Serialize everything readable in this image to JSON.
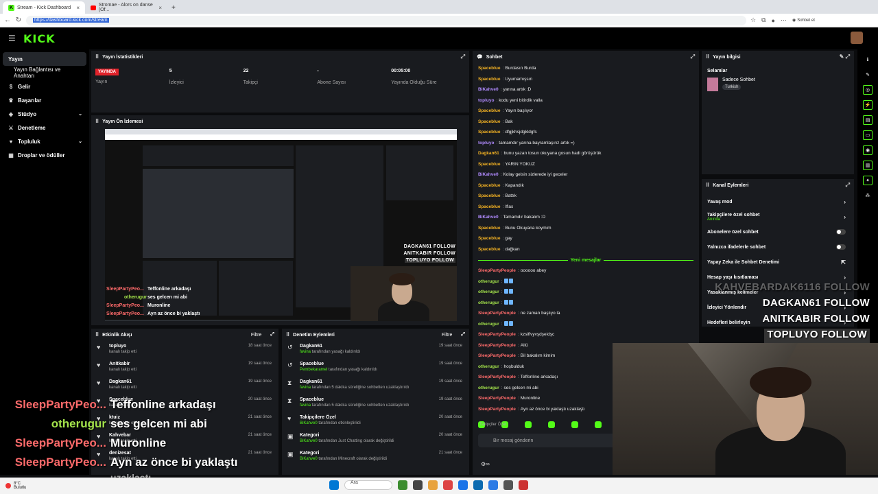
{
  "browser": {
    "tabs": [
      {
        "label": "Stream - Kick Dashboard",
        "active": true
      },
      {
        "label": "Stromae - Alors on danse (Of...",
        "active": false
      }
    ],
    "url": "https://dashboard.kick.com/stream",
    "sohbet_label": "Sohbet et"
  },
  "app": {
    "logo": "KICK"
  },
  "sidebar": {
    "items": [
      {
        "label": "Yayın",
        "icon": "broadcast-icon"
      },
      {
        "label": "Yayın Bağlantısı ve Anahtarı",
        "icon": ""
      },
      {
        "label": "Gelir",
        "icon": "money-icon"
      },
      {
        "label": "Başarılar",
        "icon": "trophy-icon"
      },
      {
        "label": "Stüdyo",
        "icon": "studio-icon"
      },
      {
        "label": "Denetleme",
        "icon": "sword-icon"
      },
      {
        "label": "Topluluk",
        "icon": "community-icon"
      },
      {
        "label": "Droplar ve ödüller",
        "icon": "gift-icon"
      }
    ]
  },
  "stats": {
    "title": "Yayın İstatistikleri",
    "live_badge": "YAYINDA",
    "live_label": "Yayın",
    "items": [
      {
        "value": "5",
        "label": "İzleyici"
      },
      {
        "value": "22",
        "label": "Takipçi"
      },
      {
        "value": "-",
        "label": "Abone Sayısı"
      },
      {
        "value": "00:05:00",
        "label": "Yayında Olduğu Süre"
      }
    ]
  },
  "preview": {
    "title": "Yayın Ön İzlemesi",
    "chat_lines": [
      {
        "user": "SleepPartyPeo...",
        "msg": "Teffonline arkadaşı"
      },
      {
        "user": "otherugur",
        "msg": "ses gelcen mi abi"
      },
      {
        "user": "SleepPartyPeo...",
        "msg": "Muronline"
      },
      {
        "user": "SleepPartyPeo...",
        "msg": "Ayn az önce bi yaklaştı"
      }
    ],
    "follows": [
      "DAGKAN61 FOLLOW",
      "ANITKABIR FOLLOW",
      "TOPLUYO FOLLOW"
    ]
  },
  "activity": {
    "title": "Etkinlik Akışı",
    "filter": "Filtre",
    "items": [
      {
        "name": "topluyo",
        "sub": "kanalı takip etti",
        "time": "18 saat önce"
      },
      {
        "name": "Anitkabir",
        "sub": "kanalı takip etti",
        "time": "19 saat önce"
      },
      {
        "name": "Dagkan61",
        "sub": "kanalı takip etti",
        "time": "19 saat önce"
      },
      {
        "name": "Spacebluе",
        "sub": "kanalı takip etti",
        "time": "20 saat önce"
      },
      {
        "name": "ktuiz",
        "sub": "kanalı takip etti",
        "time": "21 saat önce"
      },
      {
        "name": "Kahvebar",
        "sub": "kanalı takip etti",
        "time": "21 saat önce"
      },
      {
        "name": "denizesat",
        "sub": "kanalı takip etti",
        "time": "21 saat önce"
      }
    ]
  },
  "moderation": {
    "title": "Denetim Eylemleri",
    "filter": "Filtre",
    "items": [
      {
        "name": "Dagkan61",
        "actor": "favina",
        "sub": " tarafından yasağı kaldırıldı",
        "time": "19 saat önce",
        "icon": "undo-icon"
      },
      {
        "name": "Spacebluе",
        "actor": "Pembekaramel",
        "sub": " tarafından yasağı kaldırıldı",
        "time": "19 saat önce",
        "icon": "undo-icon"
      },
      {
        "name": "Dagkan61",
        "actor": "favina",
        "sub": " tarafından 5 dakika süreliğine sohbetten uzaklaştırıldı",
        "time": "19 saat önce",
        "icon": "hourglass-icon"
      },
      {
        "name": "Spacebluе",
        "actor": "favina",
        "sub": " tarafından 5 dakika süreliğine sohbetten uzaklaştırıldı",
        "time": "19 saat önce",
        "icon": "hourglass-icon"
      },
      {
        "name": "Takipçilere Özel",
        "actor": "BiKahve0",
        "sub": " tarafından etkinleştirildi",
        "time": "20 saat önce",
        "icon": "heart-icon"
      },
      {
        "name": "Kategori",
        "actor": "BiKahve0",
        "sub": " tarafından Just Chatting olarak değiştirildi",
        "time": "20 saat önce",
        "icon": "category-icon"
      },
      {
        "name": "Kategori",
        "actor": "BiKahve0",
        "sub": " tarafından Minecraft olarak değiştirildi",
        "time": "21 saat önce",
        "icon": "category-icon"
      }
    ]
  },
  "chat": {
    "title": "Sohbet",
    "messages": [
      {
        "user": "Spacebluе",
        "text": "Burdasın Burda",
        "color": "#f5b323"
      },
      {
        "user": "Spacebluе",
        "text": "Uyumamışsın",
        "color": "#f5b323"
      },
      {
        "user": "BiKahve0",
        "text": "yarına artık :D",
        "color": "#b18bff"
      },
      {
        "user": "topluyo",
        "text": "kodu yeni bitirdik valla",
        "color": "#b18bff"
      },
      {
        "user": "Spacebluе",
        "text": "Yayın başlıyor",
        "color": "#f5b323"
      },
      {
        "user": "Spacebluе",
        "text": "Bak",
        "color": "#f5b323"
      },
      {
        "user": "Spacebluе",
        "text": "dfgjkhsjdgkldgfs",
        "color": "#f5b323"
      },
      {
        "user": "topluyo",
        "text": "tamamdır yarına bayramlaşırız artık =)",
        "color": "#b18bff"
      },
      {
        "user": "Dagkan61",
        "text": "bunu yazan tosun okuyana gosun hadi görüşürük",
        "color": "#f5b323"
      },
      {
        "user": "Spacebluе",
        "text": "YARIN YOKUZ",
        "color": "#f5b323"
      },
      {
        "user": "BiKahve0",
        "text": "Kolay gelsin sizlerede iyi geceler",
        "color": "#b18bff"
      },
      {
        "user": "Spacebluе",
        "text": "Kapandık",
        "color": "#f5b323"
      },
      {
        "user": "Spacebluе",
        "text": "Battık",
        "color": "#f5b323"
      },
      {
        "user": "Spacebluе",
        "text": "Iflas",
        "color": "#f5b323"
      },
      {
        "user": "BiKahve0",
        "text": "Tamamdır bakalım :D",
        "color": "#b18bff"
      },
      {
        "user": "Spacebluе",
        "text": "Bunu Okuyana koymim",
        "color": "#f5b323"
      },
      {
        "user": "Spacebluе",
        "text": "gay",
        "color": "#f5b323"
      },
      {
        "user": "Spacebluе",
        "text": "dağkan",
        "color": "#f5b323"
      }
    ],
    "new_label": "Yeni mesajlar",
    "new_messages": [
      {
        "user": "SleepPartyPeople",
        "text": "oooooo abey",
        "color": "#ff6b6b"
      },
      {
        "user": "otherugur",
        "text": "",
        "color": "#a4e34b"
      },
      {
        "user": "otherugur",
        "text": "",
        "color": "#a4e34b"
      },
      {
        "user": "otherugur",
        "text": "",
        "color": "#a4e34b"
      },
      {
        "user": "SleepPartyPeople",
        "text": "ne zaman başlıyo la",
        "color": "#ff6b6b"
      },
      {
        "user": "otherugur",
        "text": "",
        "color": "#a4e34b"
      },
      {
        "user": "SleepPartyPeople",
        "text": "kzsiflvyvşdşeidşc",
        "color": "#ff6b6b"
      },
      {
        "user": "SleepPartyPeople",
        "text": "Allü",
        "color": "#ff6b6b"
      },
      {
        "user": "SleepPartyPeople",
        "text": "Bil bakalım kimim",
        "color": "#ff6b6b"
      },
      {
        "user": "otherugur",
        "text": "hoşbulduk",
        "color": "#a4e34b"
      },
      {
        "user": "SleepPartyPeople",
        "text": "Teffonline arkadaşı",
        "color": "#ff6b6b"
      },
      {
        "user": "otherugur",
        "text": "ses gelcen mi abi",
        "color": "#a4e34b"
      },
      {
        "user": "SleepPartyPeople",
        "text": "Muronline",
        "color": "#ff6b6b"
      },
      {
        "user": "SleepPartyPeople",
        "text": "Ayn az önce bi yaklaştı uzaklaştı",
        "color": "#ff6b6b"
      }
    ],
    "followers_only": "Takipçiler Özel",
    "input_placeholder": "Bir mesaj gönderin"
  },
  "stream_info": {
    "title": "Yayın bilgisi",
    "stream_title": "Selamlar",
    "category": "Sadece Sohbet",
    "language": "Turkish"
  },
  "channel_actions": {
    "title": "Kanal Eylemleri",
    "items": [
      {
        "label": "Yavaş mod",
        "type": "chevron",
        "sub": ""
      },
      {
        "label": "Takipçilere özel sohbet",
        "type": "chevron",
        "sub": "Anında"
      },
      {
        "label": "Abonelere özel sohbet",
        "type": "toggle",
        "sub": ""
      },
      {
        "label": "Yalnızca ifadelerle sohbet",
        "type": "toggle",
        "sub": ""
      },
      {
        "label": "Yapay Zeka ile Sohbet Denetimi",
        "type": "external",
        "sub": ""
      },
      {
        "label": "Hesap yaşı kısıtlaması",
        "type": "chevron",
        "sub": ""
      },
      {
        "label": "Yasaklanmış kelimeler",
        "type": "chevron",
        "sub": ""
      },
      {
        "label": "İzleyici Yönlendir",
        "type": "chevron",
        "sub": ""
      },
      {
        "label": "Hedefleri belirleyin",
        "type": "chevron",
        "sub": ""
      }
    ]
  },
  "overlay": {
    "chat": [
      {
        "user": "SleepPartyPeo...",
        "msg": "Teffonline arkadaşı",
        "color": "#ff6b6b"
      },
      {
        "user": "otherugur",
        "msg": "ses gelcen mi abi",
        "color": "#a4e34b"
      },
      {
        "user": "SleepPartyPeo...",
        "msg": "Muronline",
        "color": "#ff6b6b"
      },
      {
        "user": "SleepPartyPeo...",
        "msg": "Ayn az önce bi yaklaştı",
        "color": "#ff6b6b"
      }
    ],
    "trailing": "uzaklaştı",
    "follows": [
      "KAHVEBARDAK6116 FOLLOW",
      "DAGKAN61 FOLLOW",
      "ANITKABIR FOLLOW",
      "TOPLUYO FOLLOW"
    ]
  },
  "taskbar": {
    "weather": "8°C",
    "weather_sub": "Bulutlu",
    "search": "Ara"
  },
  "colors": {
    "brand": "#53fc18",
    "live": "#e0232b"
  }
}
